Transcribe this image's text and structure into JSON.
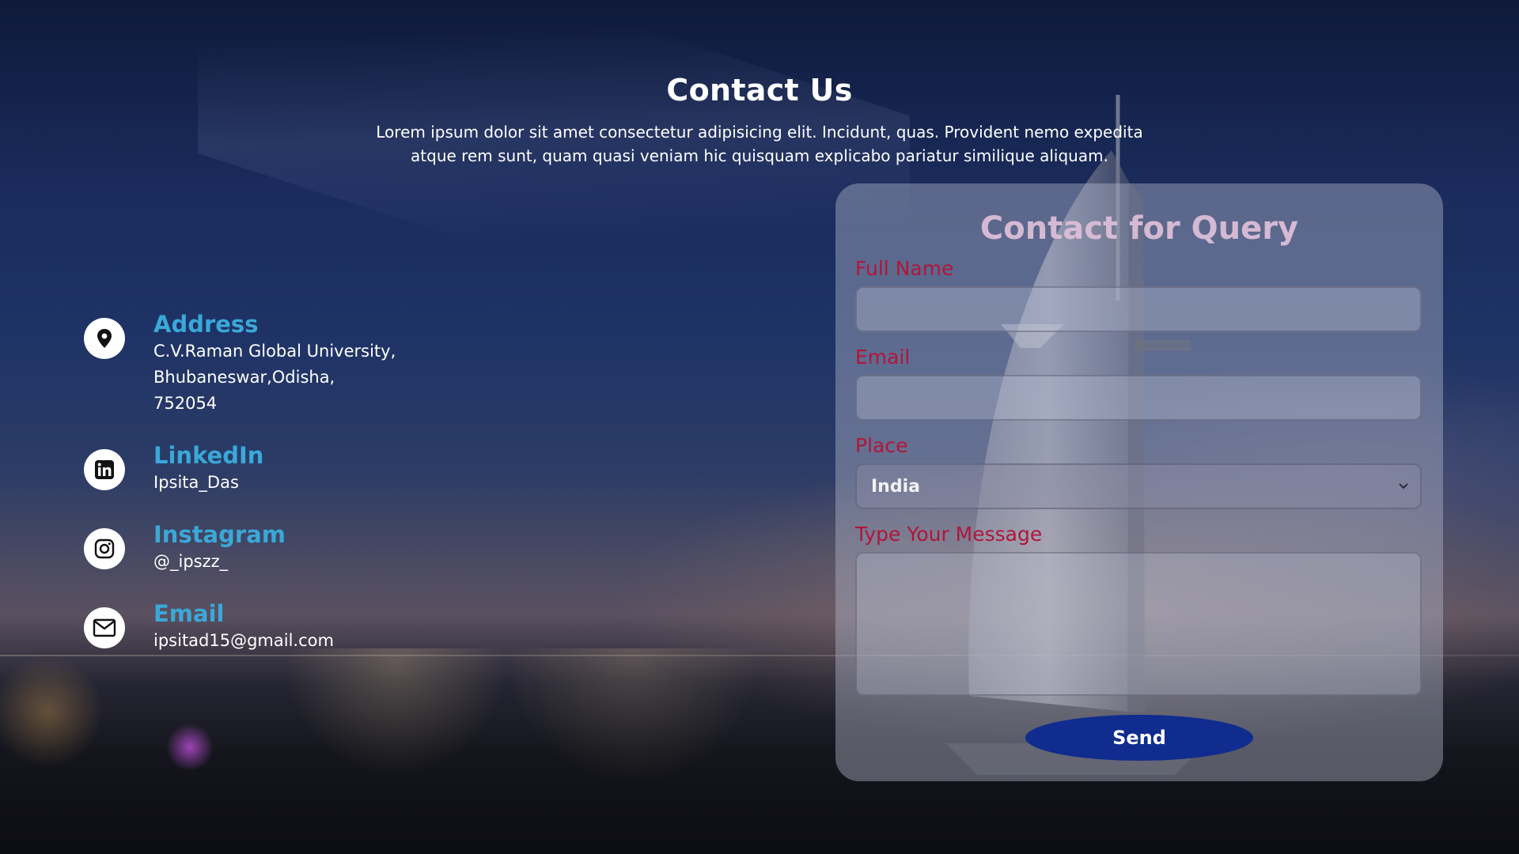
{
  "header": {
    "title": "Contact Us",
    "description": "Lorem ipsum dolor sit amet consectetur adipisicing elit. Incidunt, quas. Provident nemo expedita atque rem sunt, quam quasi veniam hic quisquam explicabo pariatur similique aliquam."
  },
  "info": {
    "address": {
      "icon": "map-pin-icon",
      "title": "Address",
      "lines": [
        "C.V.Raman Global University,",
        "Bhubaneswar,Odisha,",
        "752054"
      ]
    },
    "linkedin": {
      "icon": "linkedin-icon",
      "title": "LinkedIn",
      "value": "Ipsita_Das"
    },
    "instagram": {
      "icon": "instagram-icon",
      "title": "Instagram",
      "value": "@_ipszz_"
    },
    "email": {
      "icon": "envelope-icon",
      "title": "Email",
      "value": "ipsitad15@gmail.com"
    }
  },
  "form": {
    "title": "Contact for Query",
    "full_name_label": "Full Name",
    "full_name_value": "",
    "email_label": "Email",
    "email_value": "",
    "place_label": "Place",
    "place_selected": "India",
    "message_label": "Type Your Message",
    "message_value": "",
    "send_label": "Send"
  },
  "colors": {
    "accent_title": "#3aa8d8",
    "label": "#b0163a",
    "button": "#0f2c8e"
  }
}
